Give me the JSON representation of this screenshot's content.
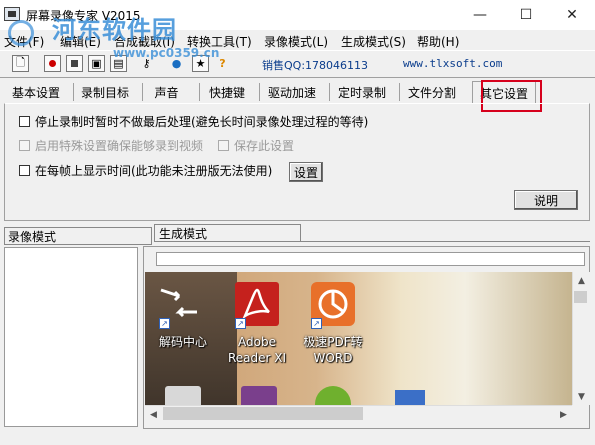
{
  "window": {
    "title": "屏幕录像专家 V2015",
    "controls": {
      "minimize": "—",
      "maximize": "☐",
      "close": "✕"
    }
  },
  "watermark": {
    "text": "河东软件园",
    "url": "www.pc0359.cn"
  },
  "menu": [
    "文件(F)",
    "编辑(E)",
    "合成截取(I)",
    "转换工具(T)",
    "录像模式(L)",
    "生成模式(S)",
    "帮助(H)"
  ],
  "toolbar": {
    "icons": [
      "new-file-icon",
      "record-icon",
      "stop-icon",
      "capture-icon",
      "window-icon",
      "key-icon",
      "globe-icon",
      "folder-star-icon",
      "help-icon"
    ],
    "sales_qq": "销售QQ:178046113",
    "website": "www.tlxsoft.com"
  },
  "tabs": [
    "基本设置",
    "录制目标",
    "声音",
    "快捷键",
    "驱动加速",
    "定时录制",
    "文件分割",
    "其它设置"
  ],
  "active_tab": "其它设置",
  "highlight_color": "#d6001c",
  "options": [
    {
      "label": "停止录制时暂时不做最后处理(避免长时间录像处理过程的等待)",
      "checked": false,
      "enabled": true
    },
    {
      "label": "启用特殊设置确保能够录到视频",
      "checked": false,
      "enabled": false
    },
    {
      "label": "保存此设置",
      "checked": false,
      "enabled": false
    },
    {
      "label": "在每帧上显示时间(此功能未注册版无法使用)",
      "checked": false,
      "enabled": true
    }
  ],
  "buttons": {
    "settings": "设置",
    "help": "说明"
  },
  "panes": {
    "left_tab": "录像模式",
    "right_tab": "生成模式"
  },
  "desktop_icons": [
    {
      "label": "解码中心",
      "icon": "decode-center-icon"
    },
    {
      "label": "Adobe Reader XI",
      "line1": "Adobe",
      "line2": "Reader XI",
      "icon": "adobe-reader-icon"
    },
    {
      "label": "极速PDF转WORD",
      "line1": "极速PDF转",
      "line2": "WORD",
      "icon": "pdf-to-word-icon"
    }
  ]
}
